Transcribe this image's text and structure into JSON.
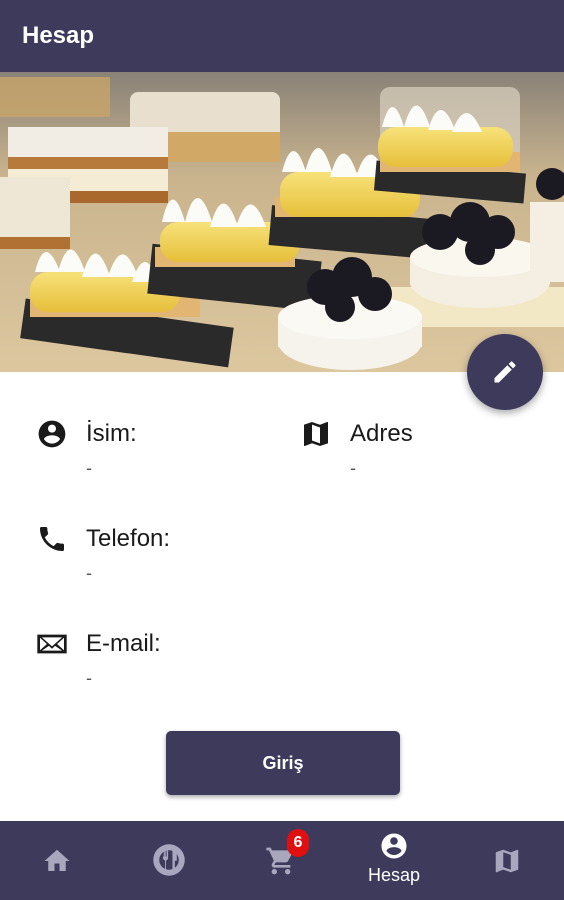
{
  "app_bar": {
    "title": "Hesap"
  },
  "hero": {
    "image": "desserts-photo"
  },
  "edit_fab": {
    "icon": "pencil-icon"
  },
  "profile": {
    "name": {
      "label": "İsim:",
      "value": "-",
      "icon": "account-circle-icon"
    },
    "address": {
      "label": "Adres",
      "value": "-",
      "icon": "map-icon"
    },
    "phone": {
      "label": "Telefon:",
      "value": "-",
      "icon": "phone-icon"
    },
    "email": {
      "label": "E-mail:",
      "value": "-",
      "icon": "mail-icon"
    }
  },
  "login_button": {
    "label": "Giriş"
  },
  "bottom_nav": {
    "items": [
      {
        "id": "home",
        "icon": "home-icon",
        "label": ""
      },
      {
        "id": "menu",
        "icon": "restaurant-icon",
        "label": ""
      },
      {
        "id": "cart",
        "icon": "cart-icon",
        "label": "",
        "badge": "6"
      },
      {
        "id": "account",
        "icon": "account-circle-icon",
        "label": "Hesap",
        "active": true
      },
      {
        "id": "map",
        "icon": "map-icon",
        "label": ""
      }
    ]
  },
  "colors": {
    "primary": "#3d3a5c",
    "badge": "#e01010",
    "background": "#ffffff"
  }
}
